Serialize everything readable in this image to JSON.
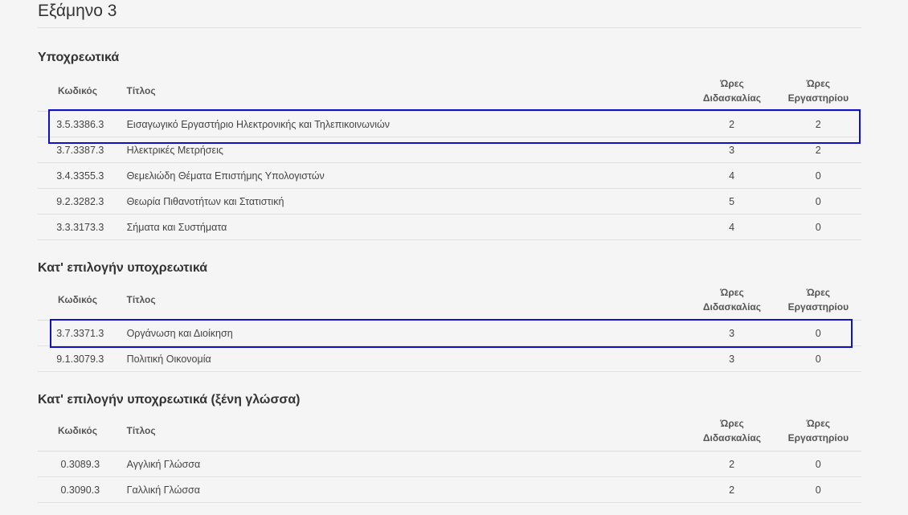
{
  "page": {
    "semester_title": "Εξάμηνο 3"
  },
  "headers": {
    "code": "Κωδικός",
    "title": "Τίτλος",
    "lecture_hours_line1": "Ώρες",
    "lecture_hours_line2": "Διδασκαλίας",
    "lab_hours_line1": "Ώρες",
    "lab_hours_line2": "Εργαστηρίου"
  },
  "sections": [
    {
      "title": "Υποχρεωτικά",
      "rows": [
        {
          "code": "3.5.3386.3",
          "title": "Εισαγωγικό Εργαστήριο Ηλεκτρονικής και Τηλεπικοινωνιών",
          "lecture": "2",
          "lab": "2"
        },
        {
          "code": "3.7.3387.3",
          "title": "Ηλεκτρικές Μετρήσεις",
          "lecture": "3",
          "lab": "2"
        },
        {
          "code": "3.4.3355.3",
          "title": "Θεμελιώδη Θέματα Επιστήμης Υπολογιστών",
          "lecture": "4",
          "lab": "0"
        },
        {
          "code": "9.2.3282.3",
          "title": "Θεωρία Πιθανοτήτων και Στατιστική",
          "lecture": "5",
          "lab": "0"
        },
        {
          "code": "3.3.3173.3",
          "title": "Σήματα και Συστήματα",
          "lecture": "4",
          "lab": "0"
        }
      ]
    },
    {
      "title": "Κατ' επιλογήν υποχρεωτικά",
      "rows": [
        {
          "code": "3.7.3371.3",
          "title": "Οργάνωση και Διοίκηση",
          "lecture": "3",
          "lab": "0"
        },
        {
          "code": "9.1.3079.3",
          "title": "Πολιτική Οικονομία",
          "lecture": "3",
          "lab": "0"
        }
      ]
    },
    {
      "title": "Κατ' επιλογήν υποχρεωτικά (ξένη γλώσσα)",
      "rows": [
        {
          "code": "0.3089.3",
          "title": "Αγγλική Γλώσσα",
          "lecture": "2",
          "lab": "0"
        },
        {
          "code": "0.3090.3",
          "title": "Γαλλική Γλώσσα",
          "lecture": "2",
          "lab": "0"
        }
      ]
    }
  ],
  "colors": {
    "highlight_border": "#1010c8",
    "background": "#f5f5f5"
  }
}
